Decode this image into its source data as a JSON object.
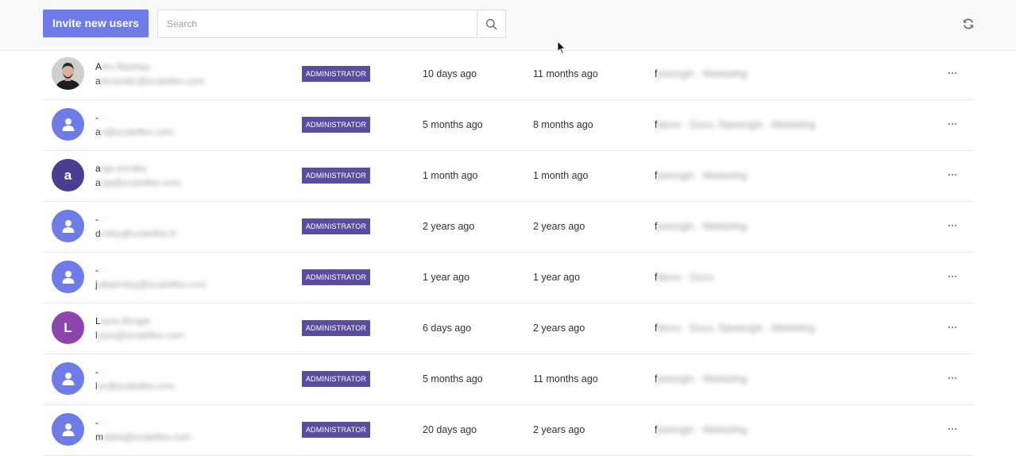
{
  "toolbar": {
    "invite_label": "Invite new users",
    "search_placeholder": "Search"
  },
  "icons": {
    "search": "search-icon",
    "refresh": "refresh-icon",
    "user": "user-icon",
    "more": "more-options-icon"
  },
  "colors": {
    "accent": "#6f7ce8",
    "badge": "#5c4c9e",
    "avatar_a": "#4b3d8f",
    "avatar_l": "#8e44ad"
  },
  "users": [
    {
      "avatar": "photo",
      "name_initial": "A",
      "name_rest": "lex Mashay",
      "email_initial": "a",
      "email_rest": "lexander@scaleflex.com",
      "role": "ADMINISTRATOR",
      "last_active": "10 days ago",
      "created": "11 months ago",
      "groups_initial": "f",
      "groups_rest": "pixengin · Marketing"
    },
    {
      "avatar": "default",
      "name_initial": "-",
      "name_rest": " ···",
      "email_initial": "a",
      "email_rest": "n@scaleflex.com",
      "role": "ADMINISTRATOR",
      "last_active": "5 months ago",
      "created": "8 months ago",
      "groups_initial": "f",
      "groups_rest": "ilerox · Doco, Djaxengin · Marketing"
    },
    {
      "avatar": "a",
      "name_initial": "a",
      "name_rest": "nja smolka",
      "email_initial": "a",
      "email_rest": "nja@scaleflex.com",
      "role": "ADMINISTRATOR",
      "last_active": "1 month ago",
      "created": "1 month ago",
      "groups_initial": "f",
      "groups_rest": "pixengin · Marketing"
    },
    {
      "avatar": "default",
      "name_initial": "-",
      "name_rest": " ···",
      "email_initial": "d",
      "email_rest": "mitry@scaleflex.fr",
      "role": "ADMINISTRATOR",
      "last_active": "2 years ago",
      "created": "2 years ago",
      "groups_initial": "f",
      "groups_rest": "pixengin · Marketing"
    },
    {
      "avatar": "default",
      "name_initial": "-",
      "name_rest": " ···",
      "email_initial": "j",
      "email_rest": "uliaerrdsy@scaleflex.com",
      "role": "ADMINISTRATOR",
      "last_active": "1 year ago",
      "created": "1 year ago",
      "groups_initial": "f",
      "groups_rest": "ilerox · Doco"
    },
    {
      "avatar": "L",
      "name_initial": "L",
      "name_rest": "aura Berger",
      "email_initial": "l",
      "email_rest": "aura@scaleflex.com",
      "role": "ADMINISTRATOR",
      "last_active": "6 days ago",
      "created": "2 years ago",
      "groups_initial": "f",
      "groups_rest": "ilerox · Doco, Djaxengin · Marketing"
    },
    {
      "avatar": "default",
      "name_initial": "-",
      "name_rest": " ···",
      "email_initial": "l",
      "email_rest": "ex@scaleflex.com",
      "role": "ADMINISTRATOR",
      "last_active": "5 months ago",
      "created": "11 months ago",
      "groups_initial": "f",
      "groups_rest": "pixengin · Marketing"
    },
    {
      "avatar": "default",
      "name_initial": "-",
      "name_rest": " ···",
      "email_initial": "m",
      "email_rest": "atiea@scaleflex.com",
      "role": "ADMINISTRATOR",
      "last_active": "20 days ago",
      "created": "2 years ago",
      "groups_initial": "f",
      "groups_rest": "pixengin · Marketing"
    }
  ]
}
